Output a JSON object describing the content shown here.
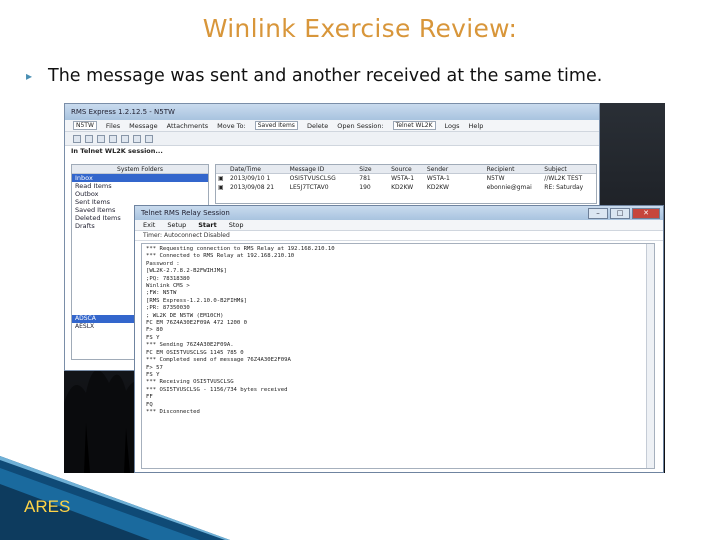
{
  "slide": {
    "title": "Winlink Exercise Review:",
    "bullet_text": "The message was sent and another received at the same time.",
    "footer_label": "ARES"
  },
  "main_window": {
    "title": "RMS Express 1.2.12.5 - N5TW",
    "menu": {
      "callsign": "N5TW",
      "items": [
        "Files",
        "Message",
        "Attachments",
        "Move To:",
        "Saved Items",
        "Delete",
        "Open Session:",
        "Telnet WL2K",
        "Logs",
        "Help"
      ]
    },
    "status": "In Telnet WL2K session...",
    "folders_header": "System Folders",
    "folders": [
      "Inbox",
      "Read Items",
      "Outbox",
      "Sent Items",
      "Saved Items",
      "Deleted Items",
      "Drafts"
    ],
    "lower_folders": [
      "ADSCA",
      "AESLX"
    ],
    "columns": [
      "",
      "Date/Time",
      "Message ID",
      "Size",
      "Source",
      "Sender",
      "Recipient",
      "Subject"
    ],
    "rows": [
      [
        "▣",
        "2013/09/10 1",
        "OSI5TVUSCLSG",
        "781",
        "W5TA-1",
        "W5TA-1",
        "N5TW",
        "//WL2K TEST"
      ],
      [
        "▣",
        "2013/09/08 21",
        "LE5J7TCTAV0",
        "190",
        "KD2KW",
        "KD2KW",
        "ebonnie@gmai",
        "RE: Saturday"
      ]
    ]
  },
  "session_window": {
    "title": "Telnet RMS Relay Session",
    "menu": [
      "Exit",
      "Setup",
      "Start",
      "Stop"
    ],
    "mode_line": "Timer: Autoconnect Disabled",
    "log_lines": [
      "*** Requesting connection to RMS Relay at 192.168.210.10",
      "*** Connected to RMS Relay at 192.168.210.10",
      "Password :",
      "[WL2K-2.7.8.2-B2FWIHJM$]",
      ";PQ: 78318380",
      "Winlink CMS >",
      "  ;FW: N5TW",
      "  [RMS Express-1.2.10.0-B2FIHM$]",
      "  ;PR: 87350030",
      "  ; WL2K DE N5TW (EM10CH)",
      "  FC EM 76Z4A30E2F09A 472 1200 0",
      "  F> 80",
      "FS Y",
      "*** Sending 76Z4A30E2F09A.",
      "FC EM OSI5TVUSCLSG 1145 785 0",
      "*** Completed send of message 76Z4A30E2F09A",
      "F> 57",
      "  FS Y",
      "*** Receiving OSI5TVUSCLSG",
      "*** OSI5TVUSCLSG - 1156/734 bytes received",
      "  FF",
      "FQ",
      "*** Disconnected"
    ]
  },
  "colors": {
    "title": "#d8963a",
    "bullet": "#4a8fb3",
    "footer": "#ffd447",
    "selection": "#3366cc"
  }
}
